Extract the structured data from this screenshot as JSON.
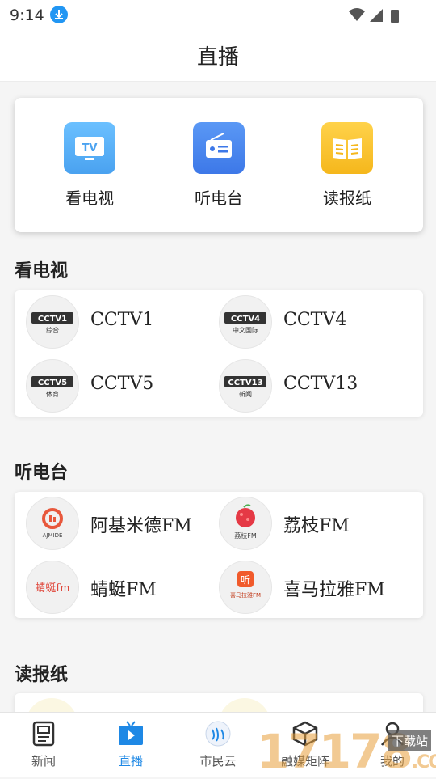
{
  "status_bar": {
    "time": "9:14"
  },
  "header": {
    "title": "直播"
  },
  "quick_links": [
    {
      "label": "看电视",
      "icon": "tv-icon",
      "color": "#5ab0f7"
    },
    {
      "label": "听电台",
      "icon": "radio-icon",
      "color": "#4a86f0"
    },
    {
      "label": "读报纸",
      "icon": "newspaper-icon",
      "color": "#f7c12d"
    }
  ],
  "tv": {
    "title": "看电视",
    "channels": [
      {
        "name": "CCTV1",
        "logo_text": "CCTV1",
        "logo_sub": "综合"
      },
      {
        "name": "CCTV4",
        "logo_text": "CCTV4",
        "logo_sub": "中文国际"
      },
      {
        "name": "CCTV5",
        "logo_text": "CCTV5",
        "logo_sub": "体育"
      },
      {
        "name": "CCTV13",
        "logo_text": "CCTV13",
        "logo_sub": "新闻"
      }
    ]
  },
  "radio": {
    "title": "听电台",
    "stations": [
      {
        "name": "阿基米德FM",
        "logo_text": "AJMIDE"
      },
      {
        "name": "荔枝FM",
        "logo_text": "荔枝FM"
      },
      {
        "name": "蜻蜓FM",
        "logo_text": "蜻蜓fm"
      },
      {
        "name": "喜马拉雅FM",
        "logo_text": "喜马拉雅FM",
        "logo_top": "听"
      }
    ]
  },
  "newspaper": {
    "title": "读报纸"
  },
  "bottom_nav": [
    {
      "label": "新闻",
      "icon": "news-icon"
    },
    {
      "label": "直播",
      "icon": "live-tv-icon",
      "active": true
    },
    {
      "label": "市民云",
      "icon": "citizen-cloud-icon"
    },
    {
      "label": "融媒矩阵",
      "icon": "cube-icon"
    },
    {
      "label": "我的",
      "icon": "user-icon"
    }
  ],
  "watermark": {
    "text": "17178",
    "sub": "下载站",
    "tail": ".COM"
  },
  "colors": {
    "accent": "#1e88e5",
    "panel_bg": "#ffffff",
    "page_bg": "#f5f5f5"
  }
}
